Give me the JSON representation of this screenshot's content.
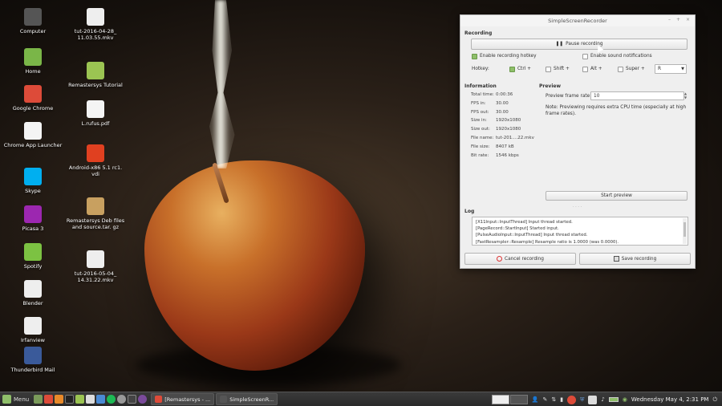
{
  "desktop": {
    "icons": [
      {
        "label": "Computer",
        "icon": "computer-icon",
        "color": "#555555"
      },
      {
        "label": "Home",
        "icon": "home-folder-icon",
        "color": "#7ab648"
      },
      {
        "label": "Google Chrome",
        "icon": "chrome-icon",
        "color": "#dd4b39"
      },
      {
        "label": "Chrome App Launcher",
        "icon": "app-launcher-icon",
        "color": "#f4f4f4"
      },
      {
        "label": "Skype",
        "icon": "skype-icon",
        "color": "#00aff0"
      },
      {
        "label": "Picasa 3",
        "icon": "picasa-icon",
        "color": "#9c27b0"
      },
      {
        "label": "Spotify",
        "icon": "spotify-icon",
        "color": "#7cc242"
      },
      {
        "label": "Blender",
        "icon": "blender-icon",
        "color": "#eeeeee"
      },
      {
        "label": "Irfanview",
        "icon": "irfanview-icon",
        "color": "#eeeeee"
      },
      {
        "label": "Thunderbird Mail",
        "icon": "thunderbird-icon",
        "color": "#3a5a9a"
      }
    ],
    "files": [
      {
        "label": "tut-2016-04-28_ 11.03.55.mkv",
        "icon": "video-file-icon",
        "color": "#eeeeee"
      },
      {
        "label": "Remastersys Tutorial",
        "icon": "folder-icon",
        "color": "#9bc452"
      },
      {
        "label": "L.rufus.pdf",
        "icon": "pdf-file-icon",
        "color": "#f4f4f4"
      },
      {
        "label": "Android-x86 5.1 rc1. vdi",
        "icon": "vdi-file-icon",
        "color": "#e04020"
      },
      {
        "label": "Remastersys Deb files and source.tar. gz",
        "icon": "archive-icon",
        "color": "#c8a060"
      },
      {
        "label": "tut-2016-05-04_ 14.31.22.mkv",
        "icon": "video-file-icon",
        "color": "#eeeeee"
      }
    ]
  },
  "window": {
    "title": "SimpleScreenRecorder",
    "recording_section": "Recording",
    "pause_label": "Pause recording",
    "enable_hotkey_label": "Enable recording hotkey",
    "enable_sound_label": "Enable sound notifications",
    "hotkey_label": "Hotkey:",
    "ctrl_label": "Ctrl +",
    "shift_label": "Shift +",
    "alt_label": "Alt +",
    "super_label": "Super +",
    "key_value": "R",
    "information_section": "Information",
    "info": [
      {
        "k": "Total time:",
        "v": "0:00:36"
      },
      {
        "k": "FPS in:",
        "v": "30.00"
      },
      {
        "k": "FPS out:",
        "v": "30.00"
      },
      {
        "k": "Size in:",
        "v": "1920x1080"
      },
      {
        "k": "Size out:",
        "v": "1920x1080"
      },
      {
        "k": "File name:",
        "v": "tut-201....22.mkv"
      },
      {
        "k": "File size:",
        "v": "8407 kB"
      },
      {
        "k": "Bit rate:",
        "v": "1546 kbps"
      }
    ],
    "preview_section": "Preview",
    "preview_rate_label": "Preview frame rate:",
    "preview_rate_value": "10",
    "preview_note": "Note: Previewing requires extra CPU time (especially at high frame rates).",
    "start_preview_label": "Start preview",
    "log_section": "Log",
    "log_lines": [
      "[X11Input::InputThread] Input thread started.",
      "[PageRecord::StartInput] Started input.",
      "[PulseAudioInput::InputThread] Input thread started.",
      "[FastResampler::Resample] Resample ratio is 1.0000 (was 0.0000)."
    ],
    "cancel_label": "Cancel recording",
    "save_label": "Save recording"
  },
  "taskbar": {
    "menu_label": "Menu",
    "tasks": [
      {
        "label": "[Remastersys - ...",
        "icon": "chrome-icon"
      },
      {
        "label": "SimpleScreenR...",
        "icon": "recorder-icon"
      }
    ],
    "clock": "Wednesday May 4, 2:31 PM"
  }
}
